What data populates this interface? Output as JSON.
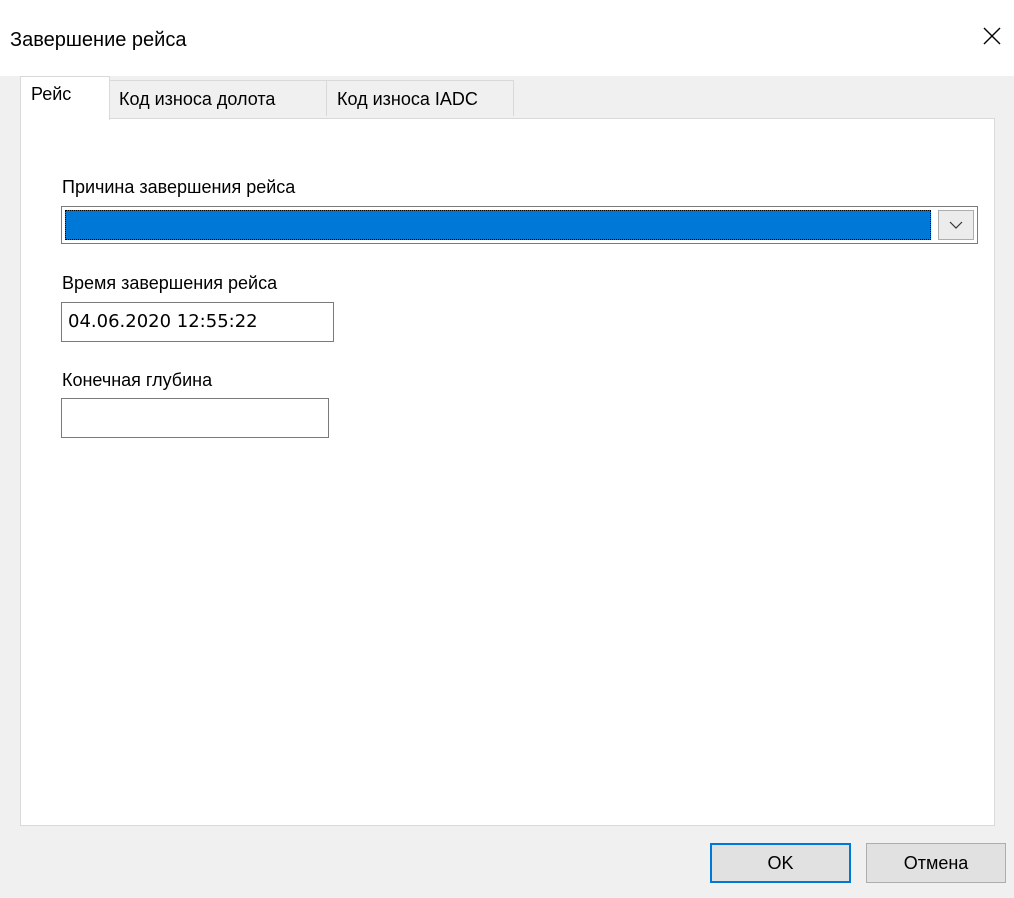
{
  "window": {
    "title": "Завершение рейса",
    "close_icon": "close-icon"
  },
  "tabs": [
    {
      "label": "Рейс",
      "active": true
    },
    {
      "label": "Код износа долота",
      "active": false
    },
    {
      "label": "Код износа IADC",
      "active": false
    }
  ],
  "form": {
    "reason": {
      "label": "Причина завершения рейса",
      "value": "",
      "dropdown_icon": "chevron-down-icon"
    },
    "end_time": {
      "label": "Время завершения рейса",
      "value": "04.06.2020 12:55:22"
    },
    "final_depth": {
      "label": "Конечная глубина",
      "value": ""
    }
  },
  "buttons": {
    "ok_label": "OK",
    "cancel_label": "Отмена"
  },
  "colors": {
    "selection": "#0078d7",
    "default_button_border": "#0078d7"
  }
}
